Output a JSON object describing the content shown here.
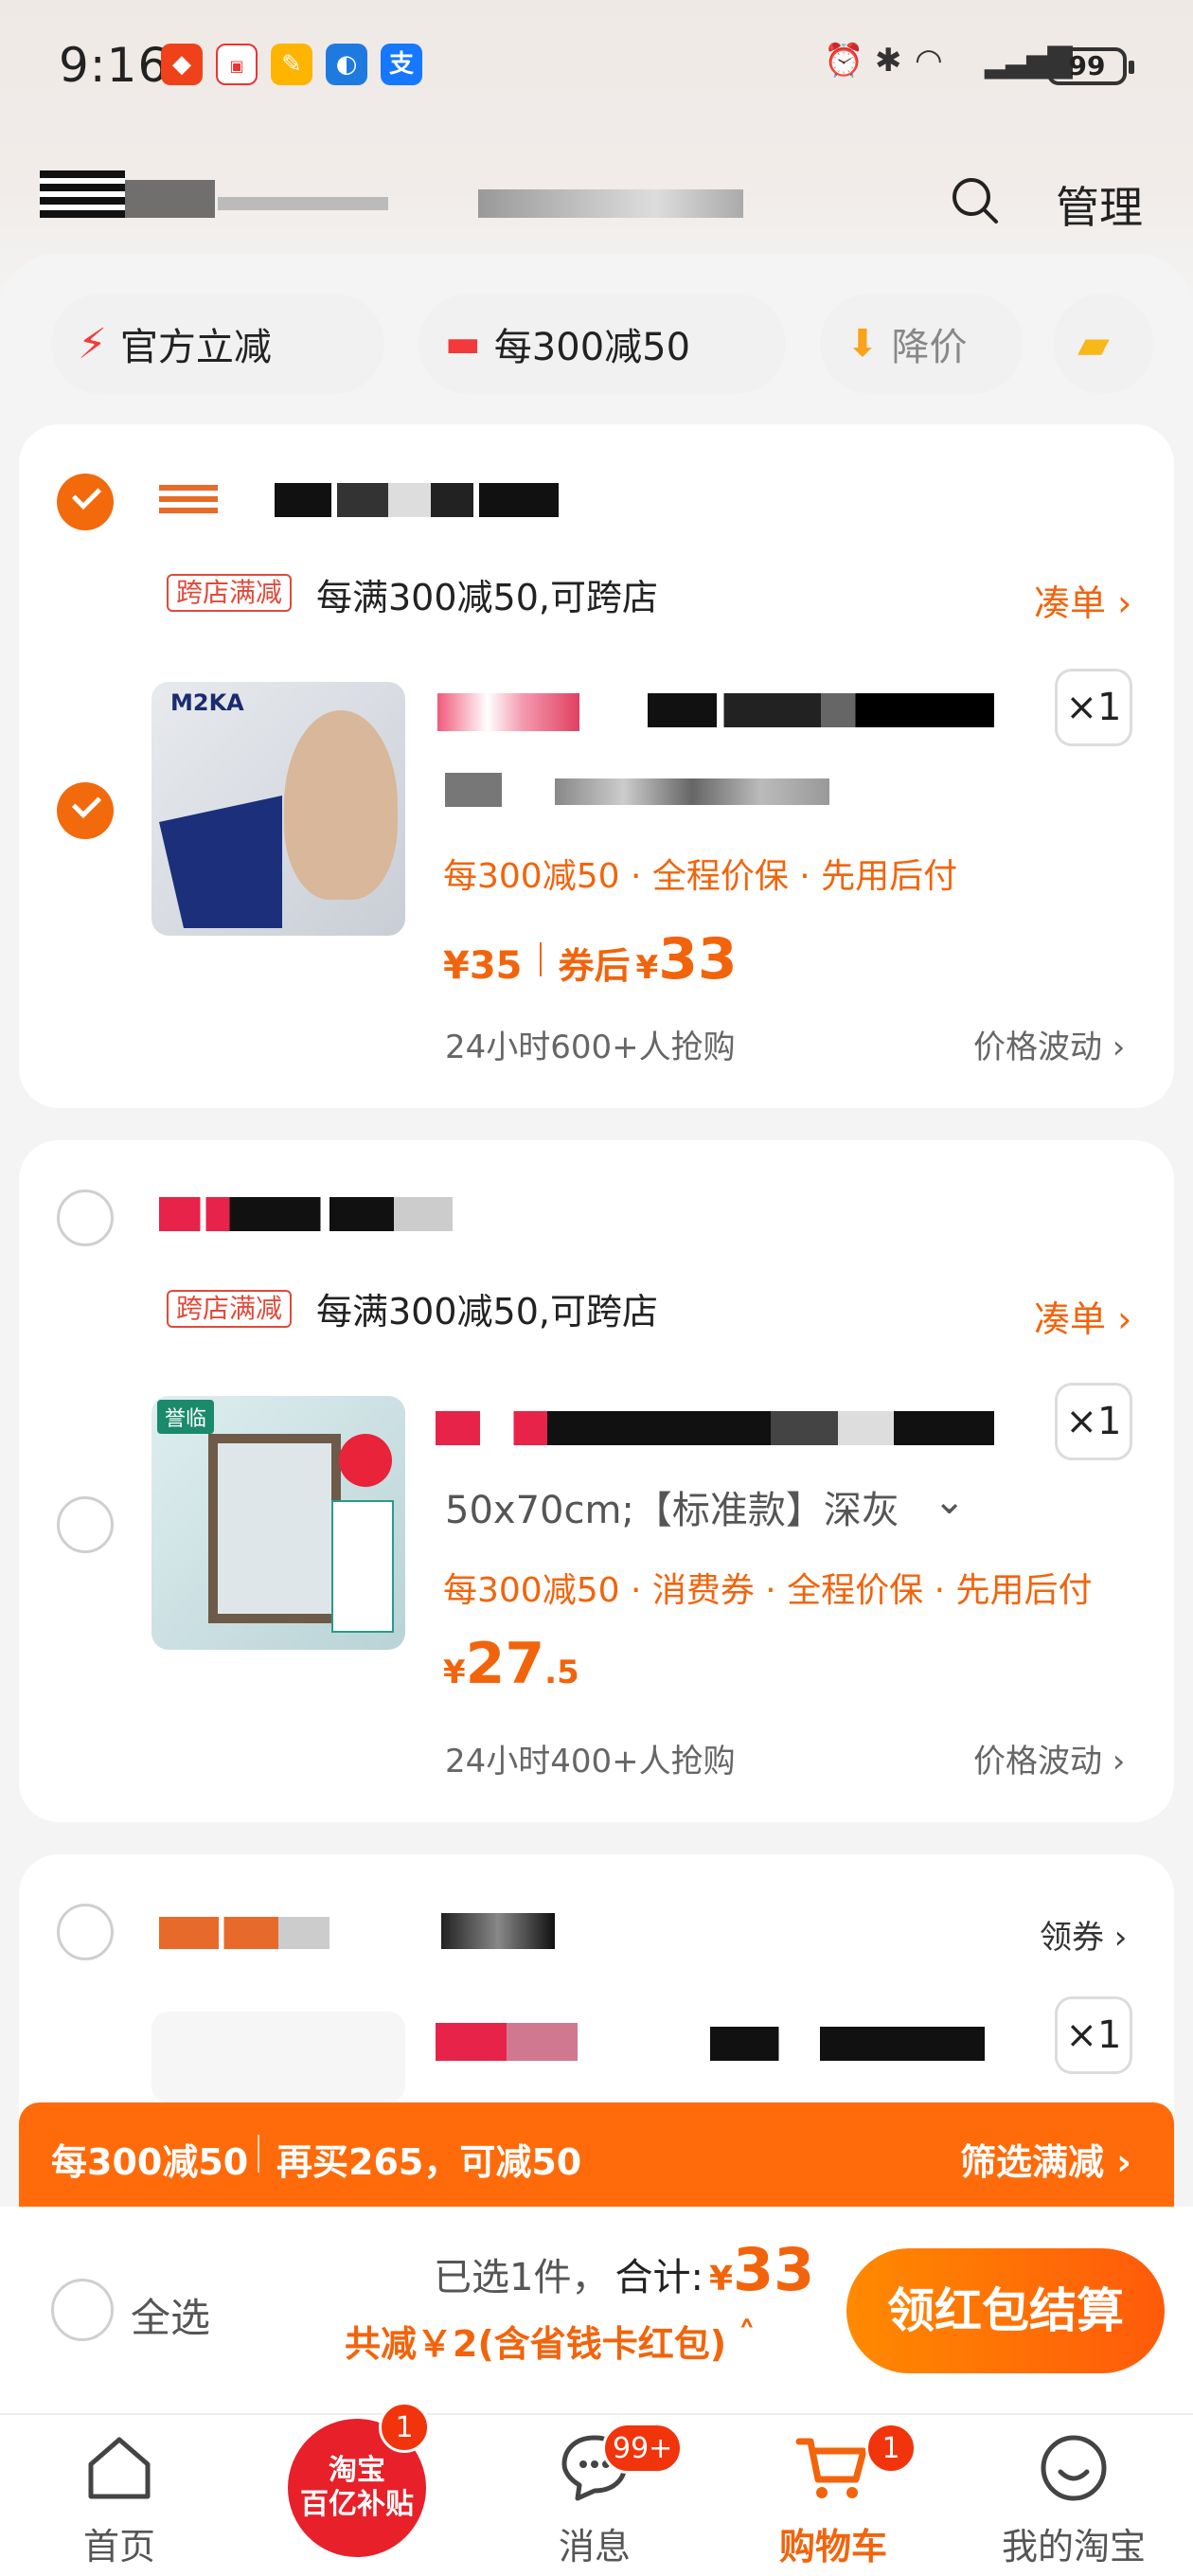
{
  "status": {
    "time": "9:16",
    "battery": "99"
  },
  "header": {
    "manage_label": "管理"
  },
  "chips": [
    {
      "label": "官方立减"
    },
    {
      "label": "每300减50"
    },
    {
      "label": "降价"
    }
  ],
  "shops": [
    {
      "promo_tag": "跨店满减",
      "promo_text": "每满300减50,可跨店",
      "action": "凑单 ›",
      "item": {
        "brand_text": "M2KA",
        "badges": "每300减50 · 全程价保 · 先用后付",
        "price": "¥35",
        "after_label": "券后",
        "after_price_symbol": "¥",
        "after_price": "33",
        "hot": "24小时600+人抢购",
        "trend": "价格波动 ›",
        "qty": "×1"
      }
    },
    {
      "promo_tag": "跨店满减",
      "promo_text": "每满300减50,可跨店",
      "action": "凑单 ›",
      "item": {
        "brand_text": "誉临",
        "sku": "50x70cm;【标准款】深灰",
        "badges": "每300减50 · 消费券 · 全程价保 · 先用后付",
        "price_symbol": "¥",
        "price_int": "27",
        "price_dec": ".5",
        "hot": "24小时400+人抢购",
        "trend": "价格波动 ›",
        "qty": "×1"
      }
    },
    {
      "action": "领券 ›",
      "item": {
        "qty": "×1"
      }
    }
  ],
  "discount_bar": {
    "left_a": "每300减50",
    "left_b": "再买265，可减50",
    "right": "筛选满减 ›"
  },
  "checkout": {
    "select_all": "全选",
    "selected": "已选1件，",
    "total_label": "合计:",
    "total_symbol": "¥",
    "total": "33",
    "saved": "共减￥2(含省钱卡红包)",
    "button": "领红包结算"
  },
  "tabs": [
    {
      "label": "首页"
    },
    {
      "label": "淘宝\n百亿补贴",
      "badge": "1"
    },
    {
      "label": "消息",
      "badge": "99+"
    },
    {
      "label": "购物车",
      "badge": "1"
    },
    {
      "label": "我的淘宝"
    }
  ],
  "colors": {
    "accent": "#f2640c",
    "tag_red": "#e04a3a"
  }
}
